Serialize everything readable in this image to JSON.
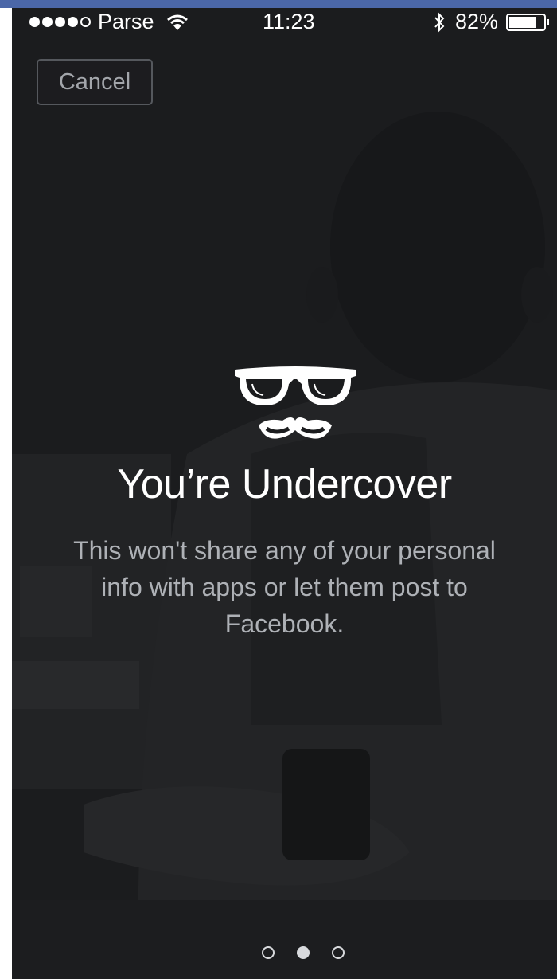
{
  "status_bar": {
    "carrier": "Parse",
    "time": "11:23",
    "battery": "82%",
    "icons": [
      "signal-dots-icon",
      "wifi-icon",
      "bluetooth-icon",
      "battery-icon"
    ],
    "signal_bars": 4,
    "battery_level": 0.82
  },
  "header": {
    "cancel_label": "Cancel"
  },
  "main": {
    "icon": "glasses-mustache-icon",
    "title": "You’re Undercover",
    "description": "This won't share any of your personal info with apps or let them post to Facebook."
  },
  "pager": {
    "count": 3,
    "active_index": 1
  },
  "colors": {
    "background": "#1b1c1e",
    "title_text": "#ffffff",
    "body_text": "#aeb1b6",
    "cancel_text": "#a3a6ab",
    "top_strip": "#4b67a8"
  }
}
